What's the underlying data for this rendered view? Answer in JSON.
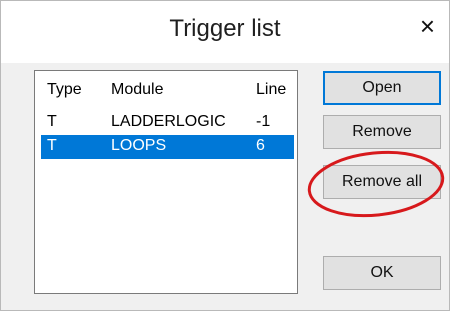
{
  "window": {
    "title": "Trigger list",
    "close_glyph": "×"
  },
  "list": {
    "columns": [
      "Type",
      "Module",
      "Line"
    ],
    "rows": [
      {
        "type": "T",
        "module": "LADDERLOGIC",
        "line": "-1",
        "selected": false
      },
      {
        "type": "T",
        "module": "LOOPS",
        "line": "6",
        "selected": true
      }
    ]
  },
  "buttons": {
    "open": "Open",
    "remove": "Remove",
    "remove_all": "Remove all",
    "ok": "OK"
  },
  "annotation": {
    "color": "#d7191c",
    "target": "Remove all"
  },
  "colors": {
    "selection": "#0078d7",
    "default_button_border": "#0078d7"
  }
}
